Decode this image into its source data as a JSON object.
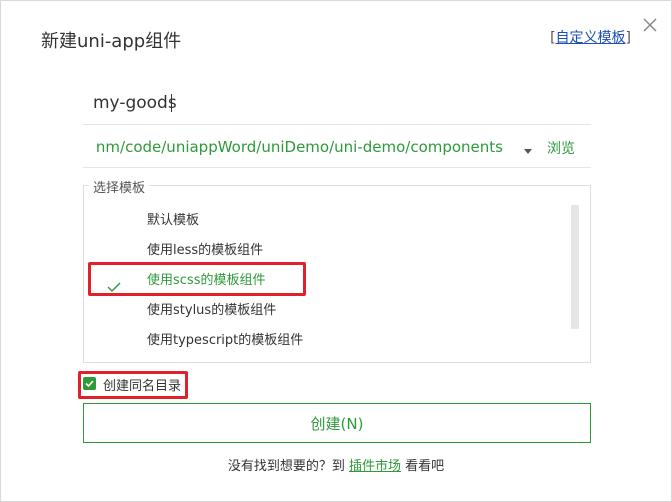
{
  "dialog": {
    "title": "新建uni-app组件",
    "custom_template": {
      "open_bracket": "[",
      "label": "自定义模板",
      "close_bracket": "]"
    },
    "close_icon": "close-icon"
  },
  "form": {
    "name_value": "my-goods",
    "path_value": "nm/code/uniappWord/uniDemo/uni-demo/components",
    "browse_label": "浏览"
  },
  "templates": {
    "legend": "选择模板",
    "items": [
      {
        "label": "默认模板",
        "selected": false
      },
      {
        "label": "使用less的模板组件",
        "selected": false
      },
      {
        "label": "使用scss的模板组件",
        "selected": true
      },
      {
        "label": "使用stylus的模板组件",
        "selected": false
      },
      {
        "label": "使用typescript的模板组件",
        "selected": false
      }
    ]
  },
  "options": {
    "same_name_dir_label": "创建同名目录",
    "same_name_dir_checked": true
  },
  "actions": {
    "create_label": "创建(N)"
  },
  "footer": {
    "prefix": "没有找到想要的？到 ",
    "market_link": "插件市场",
    "suffix": " 看看吧"
  },
  "colors": {
    "accent": "#2e9a3a",
    "annotation": "#e0202a",
    "link": "#1c4fb5"
  }
}
